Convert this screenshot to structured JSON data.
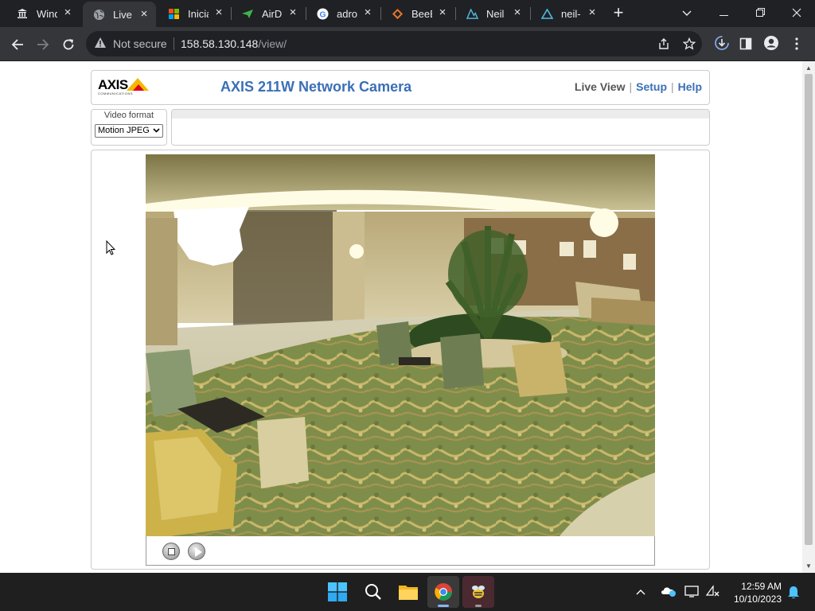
{
  "browser": {
    "tabs": [
      {
        "title": "Windo",
        "icon": "museum-icon"
      },
      {
        "title": "Live V",
        "icon": "globe-icon",
        "active": true
      },
      {
        "title": "Inicia",
        "icon": "windows-icon"
      },
      {
        "title": "AirDr",
        "icon": "airdroid-icon"
      },
      {
        "title": "adro",
        "icon": "google-icon"
      },
      {
        "title": "BeeB",
        "icon": "beebeep-icon"
      },
      {
        "title": "Neil",
        "icon": "neil-icon"
      },
      {
        "title": "neil-",
        "icon": "neil-icon"
      }
    ],
    "security_label": "Not secure",
    "url_host": "158.58.130.148",
    "url_path": "/view/"
  },
  "camera_page": {
    "logo_text": "AXIS",
    "logo_subtext": "COMMUNICATIONS",
    "title": "AXIS 211W Network Camera",
    "nav": {
      "live_view": "Live View",
      "setup": "Setup",
      "help": "Help"
    },
    "video_format_label": "Video format",
    "video_format_value": "Motion JPEG"
  },
  "taskbar": {
    "time": "12:59 AM",
    "date": "10/10/2023"
  },
  "colors": {
    "title_blue": "#3b6fb6",
    "tab_strip": "#202124",
    "toolbar": "#35363a"
  }
}
